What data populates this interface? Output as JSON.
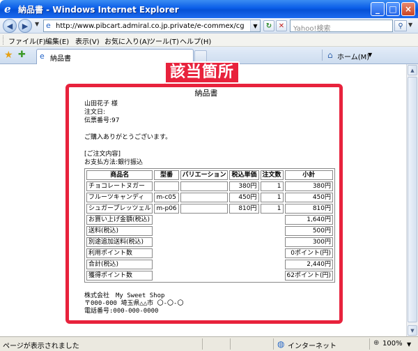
{
  "window": {
    "title": "納品書 - Windows Internet Explorer"
  },
  "address": {
    "url": "http://www.pibcart.admiral.co.jp.private/e-commex/cgi-bin/admin/ex_sa",
    "search_placeholder": "Yahoo!検索"
  },
  "menu": {
    "items": [
      "ファイル(F)",
      "編集(E)",
      "表示(V)",
      "お気に入り(A)",
      "ツール(T)",
      "ヘルプ(H)"
    ]
  },
  "tabs": {
    "active_label": "納品書",
    "home_label": "ホーム(M)"
  },
  "annotation": {
    "label": "該当箇所",
    "color": "#e8223c"
  },
  "document": {
    "title": "納品書",
    "customer": "山田花子 様",
    "order_date": "注文日:",
    "slip_number": "伝票番号:97",
    "thanks": "ご購入ありがとうございます。",
    "section_heading": "[ご注文内容]",
    "payment": "お支払方法:銀行振込",
    "table_headers": [
      "商品名",
      "型番",
      "バリエーション",
      "税込単価",
      "注文数",
      "小計"
    ],
    "items": [
      {
        "name": "チョコレートヌガー",
        "model": "",
        "variation": "",
        "price": "380円",
        "qty": "1",
        "subtotal": "380円"
      },
      {
        "name": "フルーツキャンディ",
        "model": "m-c05",
        "variation": "",
        "price": "450円",
        "qty": "1",
        "subtotal": "450円"
      },
      {
        "name": "シュガープレッツェル",
        "model": "m-p06",
        "variation": "",
        "price": "810円",
        "qty": "1",
        "subtotal": "810円"
      }
    ],
    "summary": [
      {
        "label": "お買い上げ金額(税込)",
        "value": "1,640円"
      },
      {
        "label": "送料(税込)",
        "value": "500円"
      },
      {
        "label": "別途追加送料(税込)",
        "value": "300円"
      },
      {
        "label": "利用ポイント数",
        "value": "0ポイント(円)"
      },
      {
        "label": "合計(税込)",
        "value": "2,440円"
      },
      {
        "label": "獲得ポイント数",
        "value": "62ポイント(円)"
      }
    ],
    "shop_name": "株式会社　My Sweet Shop",
    "shop_address": "〒000-000 埼玉県△△市 〇-〇-〇",
    "shop_phone": "電話番号:000-000-0000"
  },
  "status": {
    "text": "ページが表示されました",
    "zone": "インターネット",
    "zoom": "100%"
  }
}
